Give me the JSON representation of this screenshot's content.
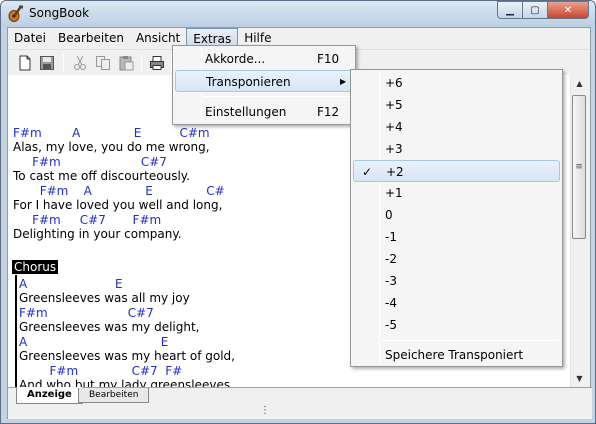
{
  "window": {
    "title": "SongBook",
    "controls": {
      "minimize": "▁",
      "maximize": "▢",
      "close": "✕"
    }
  },
  "menubar": [
    "Datei",
    "Bearbeiten",
    "Ansicht",
    "Extras",
    "Hilfe"
  ],
  "toolbar": {
    "icons": [
      "new-file-icon",
      "save-icon",
      "cut-icon",
      "copy-icon",
      "paste-icon",
      "print-icon"
    ]
  },
  "song": {
    "verse_lines": [
      {
        "chords": "F#m        A              E          C#m",
        "text": "Alas, my love, you do me wrong,"
      },
      {
        "chords": "     F#m                     C#7",
        "text": "To cast me off discourteously."
      },
      {
        "chords": "       F#m    A              E              C#",
        "text": "For I have loved you well and long,"
      },
      {
        "chords": "     F#m     C#7       F#m",
        "text": "Delighting in your company."
      }
    ],
    "chorus_label": "Chorus",
    "chorus_lines": [
      {
        "chords": "A                       E",
        "text": "Greensleeves was all my joy"
      },
      {
        "chords": "F#m                     C#7",
        "text": "Greensleeves was my delight,"
      },
      {
        "chords": "A                                   E",
        "text": "Greensleeves was my heart of gold,"
      },
      {
        "chords": "        F#m              C#7  F#",
        "text": "And who but my lady greensleeves."
      }
    ]
  },
  "tabs": {
    "active": "Anzeige",
    "inactive": "Bearbeiten"
  },
  "extras_menu": {
    "items": [
      {
        "label": "Akkorde...",
        "accel": "F10"
      },
      {
        "label": "Transponieren",
        "accel": ""
      },
      {
        "label": "Einstellungen",
        "accel": "F12"
      }
    ]
  },
  "transpose_menu": {
    "items": [
      "+6",
      "+5",
      "+4",
      "+3",
      "+2",
      "+1",
      "0",
      "-1",
      "-2",
      "-3",
      "-4",
      "-5"
    ],
    "checked": "+2",
    "save_label": "Speichere Transponiert",
    "check_glyph": "✓",
    "submenu_arrow": "▶"
  },
  "scrollbar": {
    "up": "▲",
    "down": "▼",
    "grip": "≡"
  },
  "status": {
    "grip": "⋮"
  },
  "colors": {
    "chord": "#1f2fc9",
    "highlight": "#d6e5f7",
    "title_gradient_top": "#dbe7f3"
  }
}
